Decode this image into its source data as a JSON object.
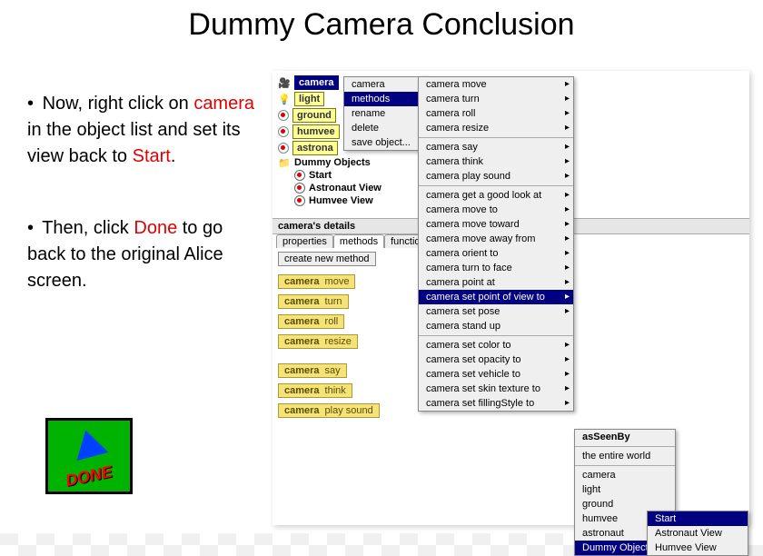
{
  "title": "Dummy Camera Conclusion",
  "instr1_prefix": "Now, right click on ",
  "instr1_camera": "camera",
  "instr1_mid": " in the object list and set its view back to ",
  "instr1_start": "Start",
  "instr1_end": ".",
  "instr2_prefix": "Then, click ",
  "instr2_done": "Done",
  "instr2_end": " to go back to the original Alice screen.",
  "done_label": "DONE",
  "tree": {
    "camera": "camera",
    "light": "light",
    "ground": "ground",
    "humvee": "humvee",
    "astronaut": "astrona",
    "dummy_folder": "Dummy Objects",
    "start": "Start",
    "astronaut_view": "Astronaut View",
    "humvee_view": "Humvee View"
  },
  "details_header": "camera's details",
  "tabs": {
    "properties": "properties",
    "methods": "methods",
    "functions": "functions"
  },
  "create_btn": "create new method",
  "tiles": [
    {
      "a": "camera",
      "b": "move"
    },
    {
      "a": "camera",
      "b": "turn"
    },
    {
      "a": "camera",
      "b": "roll"
    },
    {
      "a": "camera",
      "b": "resize"
    },
    {
      "a": "camera",
      "b": "say"
    },
    {
      "a": "camera",
      "b": "think"
    },
    {
      "a": "camera",
      "b": "play sound"
    }
  ],
  "ctx1": {
    "camera": "camera",
    "methods": "methods",
    "rename": "rename",
    "delete": "delete",
    "save": "save object..."
  },
  "ctx2": [
    {
      "t": "camera move",
      "sub": true
    },
    {
      "t": "camera turn",
      "sub": true
    },
    {
      "t": "camera roll",
      "sub": true
    },
    {
      "t": "camera resize",
      "sub": true
    },
    {
      "sep": true
    },
    {
      "t": "camera say",
      "sub": true
    },
    {
      "t": "camera think",
      "sub": true
    },
    {
      "t": "camera play sound",
      "sub": true
    },
    {
      "sep": true
    },
    {
      "t": "camera get a good look at",
      "sub": true
    },
    {
      "t": "camera move to",
      "sub": true
    },
    {
      "t": "camera move  toward",
      "sub": true
    },
    {
      "t": "camera move  away from",
      "sub": true
    },
    {
      "t": "camera orient to",
      "sub": true
    },
    {
      "t": "camera turn to face",
      "sub": true
    },
    {
      "t": "camera point at",
      "sub": true
    },
    {
      "t": "camera set point of view to",
      "sub": true,
      "hl": true
    },
    {
      "t": "camera set pose",
      "sub": true
    },
    {
      "t": "camera stand up"
    },
    {
      "sep": true
    },
    {
      "t": "camera set color to",
      "sub": true
    },
    {
      "t": "camera set opacity to",
      "sub": true
    },
    {
      "t": "camera set vehicle to",
      "sub": true
    },
    {
      "t": "camera set skin texture to",
      "sub": true
    },
    {
      "t": "camera set fillingStyle to",
      "sub": true
    }
  ],
  "ctx3": [
    {
      "t": "asSeenBy",
      "bold": true
    },
    {
      "sep": true
    },
    {
      "t": "the entire world"
    },
    {
      "sep": true
    },
    {
      "t": "camera"
    },
    {
      "t": "light"
    },
    {
      "t": "ground"
    },
    {
      "t": "humvee",
      "sub": true
    },
    {
      "t": "astronaut",
      "sub": true
    },
    {
      "t": "Dummy Objects",
      "sub": true,
      "hl": true
    }
  ],
  "ctx4": [
    {
      "t": "Start",
      "hl": true
    },
    {
      "t": "Astronaut View"
    },
    {
      "t": "Humvee View"
    }
  ]
}
